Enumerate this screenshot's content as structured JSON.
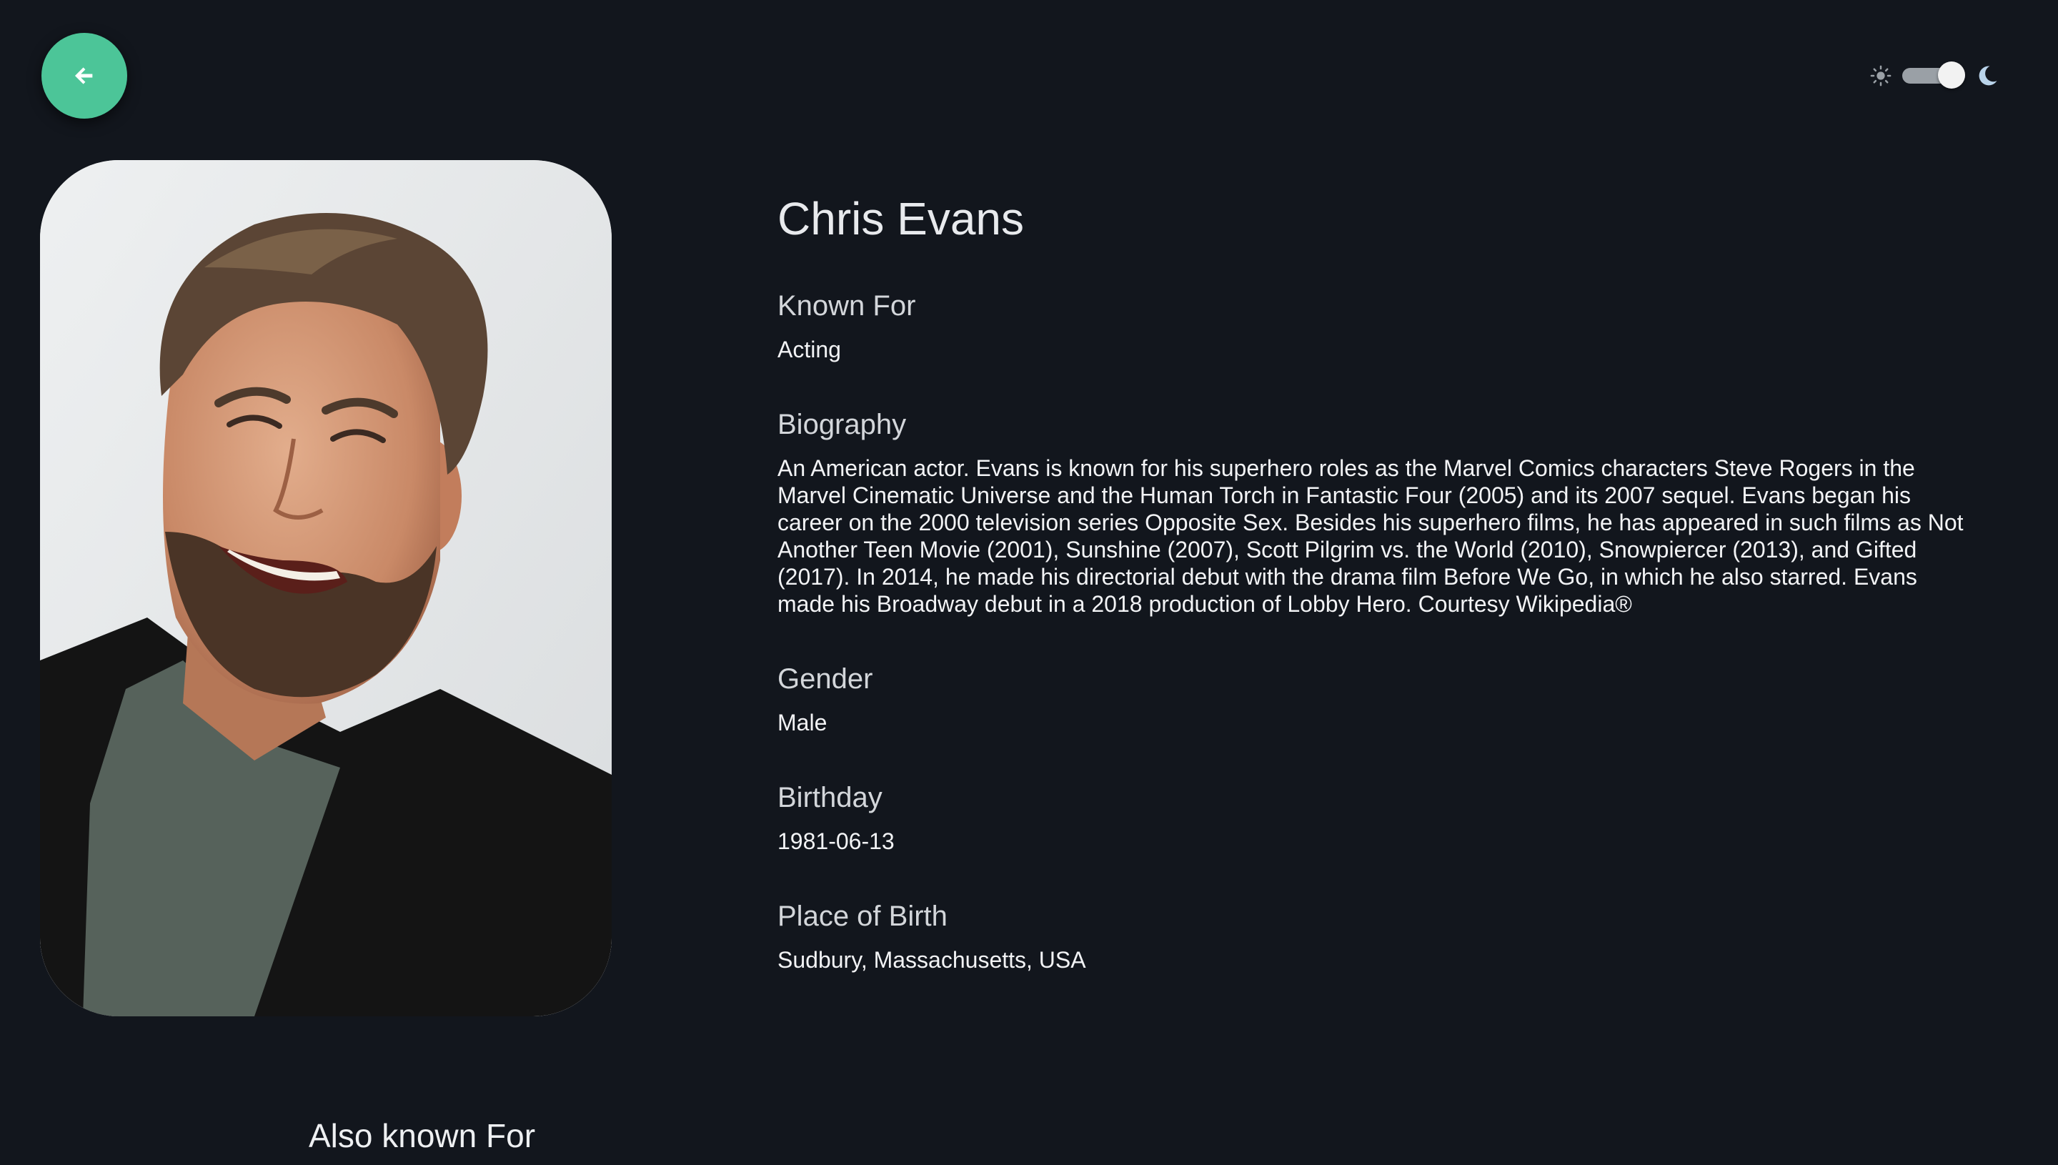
{
  "header": {
    "back_icon": "arrow-left-icon",
    "theme_toggle": {
      "sun_icon": "sun-icon",
      "moon_icon": "moon-icon",
      "state": "dark"
    }
  },
  "profile": {
    "name": "Chris Evans",
    "known_for_label": "Known For",
    "known_for": "Acting",
    "biography_label": "Biography",
    "biography": "An American actor. Evans is known for his superhero roles as the Marvel Comics characters Steve Rogers in the Marvel Cinematic Universe and the Human Torch in Fantastic Four (2005) and its 2007 sequel. Evans began his career on the 2000 television series Opposite Sex. Besides his superhero films, he has appeared in such films as Not Another Teen Movie (2001), Sunshine (2007), Scott Pilgrim vs. the World (2010), Snowpiercer (2013), and Gifted (2017). In 2014, he made his directorial debut with the drama film Before We Go, in which he also starred. Evans made his Broadway debut in a 2018 production of Lobby Hero. Courtesy Wikipedia®",
    "gender_label": "Gender",
    "gender": "Male",
    "birthday_label": "Birthday",
    "birthday": "1981-06-13",
    "place_of_birth_label": "Place of Birth",
    "place_of_birth": "Sudbury, Massachusetts, USA"
  },
  "also_known_for": {
    "heading": "Also known For"
  },
  "colors": {
    "background": "#12161d",
    "accent": "#4cc598"
  }
}
